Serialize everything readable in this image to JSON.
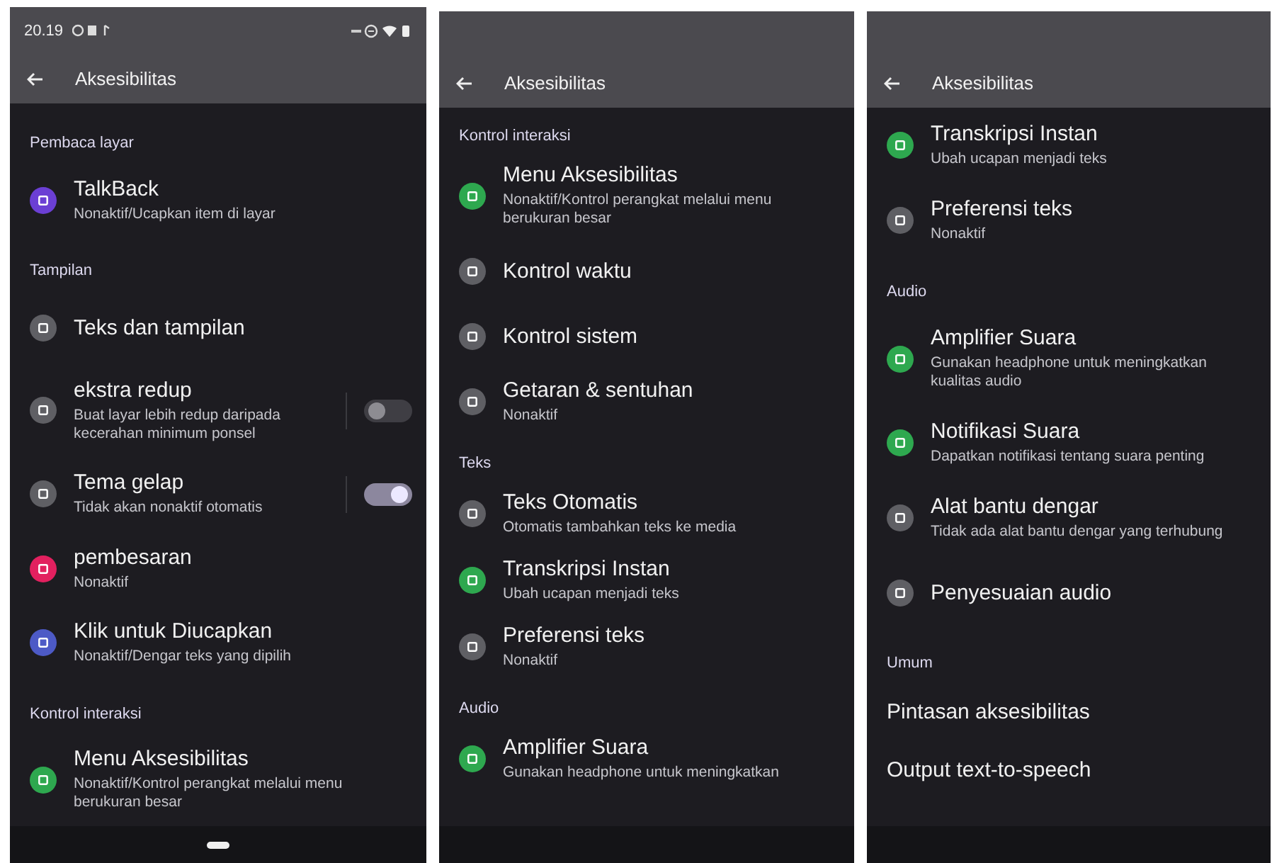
{
  "panels": [
    {
      "status_bar": {
        "time": "20.19"
      },
      "title": "Aksesibilitas",
      "gesture_handle": true,
      "items": [
        {
          "kind": "header",
          "title": "Pembaca layar"
        },
        {
          "kind": "item",
          "title": "TalkBack",
          "subtitle": "Nonaktif/Ucapkan item di layar",
          "color": "#6b3fd4"
        },
        {
          "kind": "header",
          "title": "Tampilan"
        },
        {
          "kind": "item",
          "title": "Teks dan tampilan",
          "color": "#5f5f64"
        },
        {
          "kind": "toggle",
          "title": "ekstra redup",
          "subtitle": "Buat layar lebih redup daripada kecerahan minimum ponsel",
          "color": "#5f5f64",
          "on": false
        },
        {
          "kind": "toggle",
          "title": "Tema gelap",
          "subtitle": "Tidak akan nonaktif otomatis",
          "color": "#5f5f64",
          "on": true
        },
        {
          "kind": "item",
          "title": "pembesaran",
          "subtitle": "Nonaktif",
          "color": "#e2205f"
        },
        {
          "kind": "item",
          "title": "Klik untuk Diucapkan",
          "subtitle": "Nonaktif/Dengar teks yang dipilih",
          "color": "#4d5ac6"
        },
        {
          "kind": "header",
          "title": "Kontrol interaksi"
        },
        {
          "kind": "item",
          "title": "Menu Aksesibilitas",
          "subtitle": "Nonaktif/Kontrol perangkat melalui menu berukuran besar",
          "color": "#2ea84f"
        }
      ]
    },
    {
      "title": "Aksesibilitas",
      "gesture_handle": false,
      "items": [
        {
          "kind": "header",
          "title": "Kontrol interaksi"
        },
        {
          "kind": "item",
          "title": "Menu Aksesibilitas",
          "subtitle": "Nonaktif/Kontrol perangkat melalui menu berukuran besar",
          "color": "#2ea84f"
        },
        {
          "kind": "item",
          "title": "Kontrol waktu",
          "color": "#5f5f64"
        },
        {
          "kind": "item",
          "title": "Kontrol sistem",
          "color": "#5f5f64"
        },
        {
          "kind": "item",
          "title": "Getaran & sentuhan",
          "subtitle": "Nonaktif",
          "color": "#5f5f64"
        },
        {
          "kind": "header",
          "title": "Teks"
        },
        {
          "kind": "item",
          "title": "Teks Otomatis",
          "subtitle": "Otomatis tambahkan teks ke media",
          "color": "#5f5f64"
        },
        {
          "kind": "item",
          "title": "Transkripsi Instan",
          "subtitle": "Ubah ucapan menjadi teks",
          "color": "#2ea84f"
        },
        {
          "kind": "item",
          "title": "Preferensi teks",
          "subtitle": "Nonaktif",
          "color": "#5f5f64"
        },
        {
          "kind": "header",
          "title": "Audio"
        },
        {
          "kind": "item",
          "title": "Amplifier Suara",
          "subtitle": "Gunakan headphone untuk meningkatkan",
          "color": "#2ea84f"
        }
      ]
    },
    {
      "title": "Aksesibilitas",
      "gesture_handle": false,
      "items": [
        {
          "kind": "item",
          "title": "Transkripsi Instan",
          "subtitle": "Ubah ucapan menjadi teks",
          "color": "#2ea84f"
        },
        {
          "kind": "item",
          "title": "Preferensi teks",
          "subtitle": "Nonaktif",
          "color": "#5f5f64"
        },
        {
          "kind": "header",
          "title": "Audio"
        },
        {
          "kind": "item",
          "title": "Amplifier Suara",
          "subtitle": "Gunakan headphone untuk meningkatkan kualitas audio",
          "color": "#2ea84f"
        },
        {
          "kind": "item",
          "title": "Notifikasi Suara",
          "subtitle": "Dapatkan notifikasi tentang suara penting",
          "color": "#2ea84f"
        },
        {
          "kind": "item",
          "title": "Alat bantu dengar",
          "subtitle": "Tidak ada alat bantu dengar yang terhubung",
          "color": "#5f5f64"
        },
        {
          "kind": "item",
          "title": "Penyesuaian audio",
          "color": "#5f5f64"
        },
        {
          "kind": "header",
          "title": "Umum"
        },
        {
          "kind": "plain",
          "title": "Pintasan aksesibilitas"
        },
        {
          "kind": "plain",
          "title": "Output text-to-speech"
        }
      ]
    }
  ]
}
